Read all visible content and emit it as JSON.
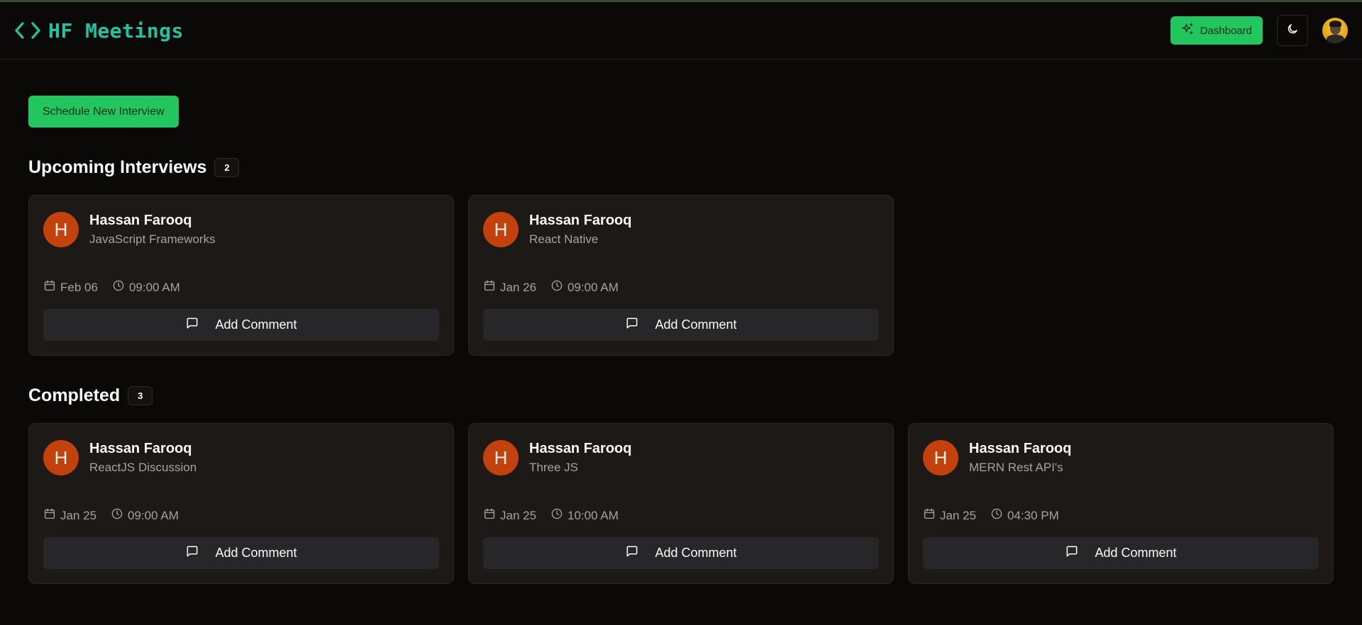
{
  "header": {
    "brand": "HF Meetings",
    "dashboard_label": "Dashboard"
  },
  "actions": {
    "schedule_label": "Schedule New Interview"
  },
  "upcoming": {
    "title": "Upcoming Interviews",
    "count": "2",
    "cards": [
      {
        "initial": "H",
        "name": "Hassan Farooq",
        "topic": "JavaScript Frameworks",
        "date": "Feb 06",
        "time": "09:00 AM",
        "comment_label": "Add Comment"
      },
      {
        "initial": "H",
        "name": "Hassan Farooq",
        "topic": "React Native",
        "date": "Jan 26",
        "time": "09:00 AM",
        "comment_label": "Add Comment"
      }
    ]
  },
  "completed": {
    "title": "Completed",
    "count": "3",
    "cards": [
      {
        "initial": "H",
        "name": "Hassan Farooq",
        "topic": "ReactJS Discussion",
        "date": "Jan 25",
        "time": "09:00 AM",
        "comment_label": "Add Comment"
      },
      {
        "initial": "H",
        "name": "Hassan Farooq",
        "topic": "Three JS",
        "date": "Jan 25",
        "time": "10:00 AM",
        "comment_label": "Add Comment"
      },
      {
        "initial": "H",
        "name": "Hassan Farooq",
        "topic": "MERN Rest API's",
        "date": "Jan 25",
        "time": "04:30 PM",
        "comment_label": "Add Comment"
      }
    ]
  },
  "colors": {
    "accent": "#22c55e",
    "brand": "#22c3a0",
    "avatar": "#c2410c",
    "background": "#0a0908",
    "card": "#1c1917"
  },
  "icons": {
    "brand": "code-icon",
    "dashboard": "sparkles-icon",
    "theme": "moon-icon",
    "date": "calendar-icon",
    "time": "clock-icon",
    "comment": "message-square-icon"
  }
}
